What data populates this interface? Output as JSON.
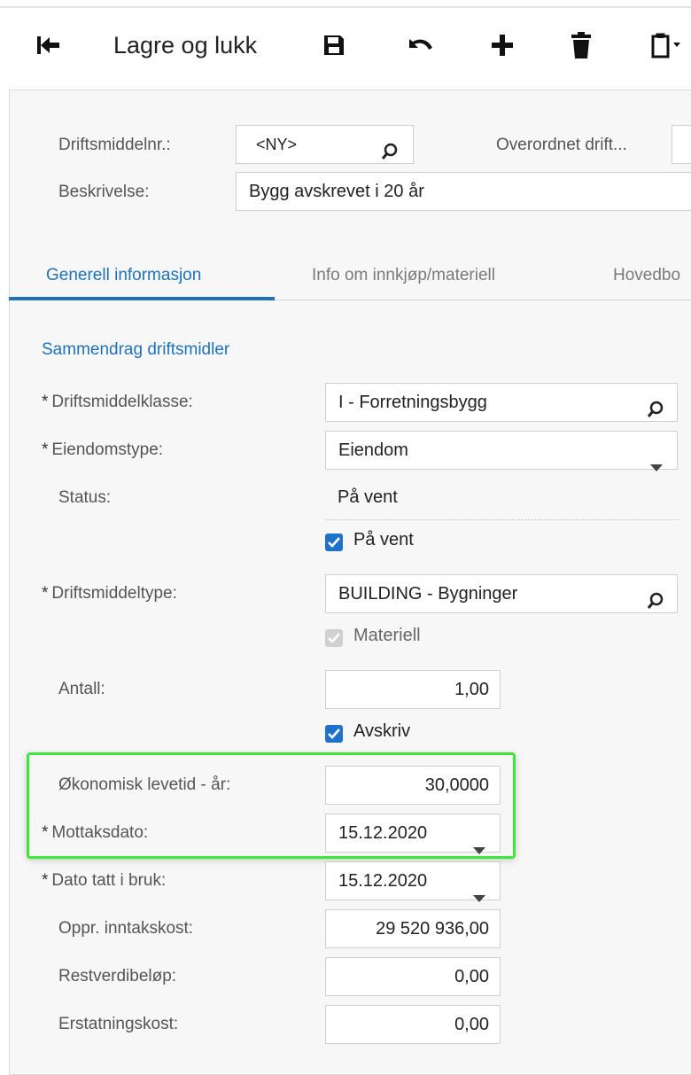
{
  "toolbar": {
    "back_icon": "arrow-left-icon",
    "save_close_label": "Lagre og lukk",
    "save_icon": "floppy-disk-icon",
    "undo_icon": "undo-icon",
    "add_icon": "plus-icon",
    "delete_icon": "trash-icon",
    "clipboard_icon": "clipboard-icon"
  },
  "header": {
    "asset_no_label": "Driftsmiddelnr.:",
    "asset_no_value": "<NY>",
    "parent_label": "Overordnet drift...",
    "description_label": "Beskrivelse:",
    "description_value": "Bygg avskrevet i 20 år"
  },
  "tabs": [
    {
      "label": "Generell informasjon",
      "active": true
    },
    {
      "label": "Info om innkjøp/materiell",
      "active": false
    },
    {
      "label": "Hovedbo",
      "active": false
    }
  ],
  "section_title": "Sammendrag driftsmidler",
  "form": {
    "asset_class_label": "Driftsmiddelklasse:",
    "asset_class_value": "I - Forretningsbygg",
    "property_type_label": "Eiendomstype:",
    "property_type_value": "Eiendom",
    "status_label": "Status:",
    "status_value": "På vent",
    "on_hold_checkbox_label": "På vent",
    "on_hold_checked": true,
    "asset_type_label": "Driftsmiddeltype:",
    "asset_type_value": "BUILDING - Bygninger",
    "tangible_checkbox_label": "Materiell",
    "tangible_checked": true,
    "quantity_label": "Antall:",
    "quantity_value": "1,00",
    "depreciate_checkbox_label": "Avskriv",
    "depreciate_checked": true,
    "useful_life_label": "Økonomisk levetid - år:",
    "useful_life_value": "30,0000",
    "receipt_date_label": "Mottaksdato:",
    "receipt_date_value": "15.12.2020",
    "placed_in_service_label": "Dato tatt i bruk:",
    "placed_in_service_value": "15.12.2020",
    "orig_acq_cost_label": "Oppr. inntakskost:",
    "orig_acq_cost_value": "29 520 936,00",
    "salvage_label": "Restverdibeløp:",
    "salvage_value": "0,00",
    "replacement_label": "Erstatningskost:",
    "replacement_value": "0,00",
    "required_marker": "*"
  },
  "colors": {
    "accent": "#1f72b8",
    "highlight_border": "#3ee63a",
    "checkbox": "#1f72c9",
    "panel_bg": "#f7f7f7"
  }
}
